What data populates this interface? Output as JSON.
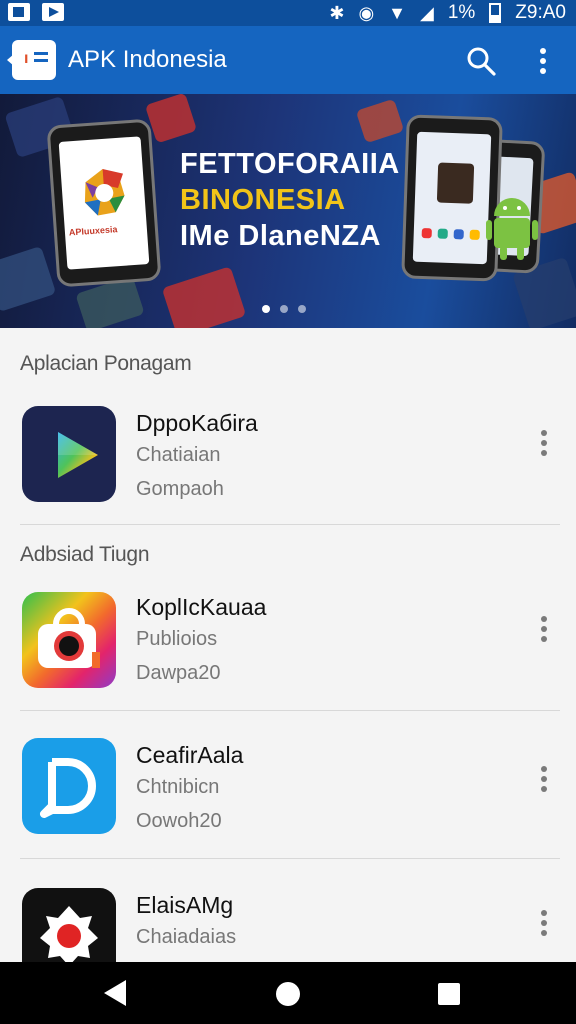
{
  "status_bar": {
    "battery": "1%",
    "time": "Z9:A0",
    "icons": [
      "notification-square-icon",
      "play-store-icon",
      "bluetooth-icon",
      "alarm-icon",
      "wifi-icon",
      "signal-icon",
      "battery-icon"
    ]
  },
  "app_bar": {
    "title": "APK Indonesia",
    "icons": [
      "app-logo-icon",
      "search-icon",
      "more-vert-icon"
    ],
    "color": "#1565c0"
  },
  "banner": {
    "line1": "FETTOFORAIIA",
    "line2": "BINONESIA",
    "line3": "IMe DlaneNZA",
    "phone_label": "APIuuxesia",
    "line2_color": "#f2c418",
    "dots_count": 3,
    "active_dot": 0
  },
  "sections": [
    {
      "title": "Aplacian Ponagam",
      "apps": [
        {
          "name": "DppoKaбira",
          "line1": "Chatiaian",
          "line2": "Gompaoh",
          "icon": "play-triangle-icon"
        }
      ]
    },
    {
      "title": "Adbsiad Tiugn",
      "apps": [
        {
          "name": "KoplIcKauaa",
          "line1": "Publioios",
          "line2": "Dawpa20",
          "icon": "camera-bag-icon"
        },
        {
          "name": "CeafirAala",
          "line1": "Chtnibicn",
          "line2": "Oowoh20",
          "icon": "d-letter-icon"
        },
        {
          "name": "ElaisAMg",
          "line1": "Chaiadaias",
          "line2": "",
          "icon": "red-dot-camera-icon"
        }
      ]
    }
  ],
  "nav_bar": {
    "icons": [
      "back-icon",
      "home-icon",
      "recents-icon"
    ]
  }
}
